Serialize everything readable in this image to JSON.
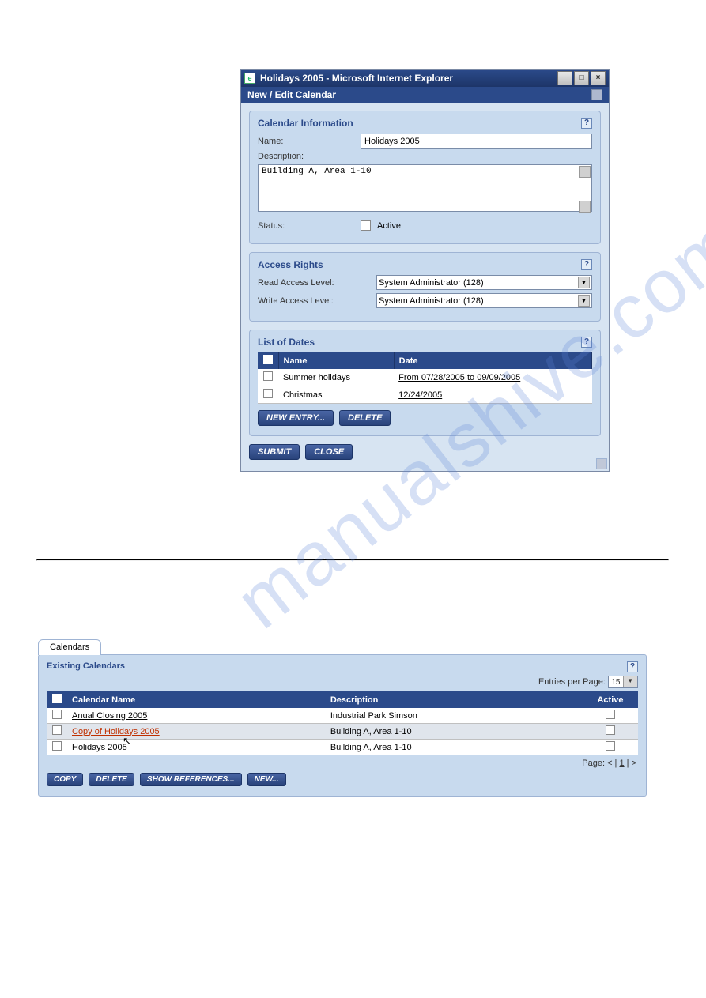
{
  "dialog": {
    "window_title": "Holidays 2005 - Microsoft Internet Explorer",
    "subheader": "New / Edit Calendar",
    "win_btns": {
      "min": "_",
      "max": "□",
      "close": "×"
    },
    "calendar_info": {
      "title": "Calendar Information",
      "name_label": "Name:",
      "name_value": "Holidays 2005",
      "description_label": "Description:",
      "description_value": "Building A, Area 1-10",
      "status_label": "Status:",
      "active_label": "Active"
    },
    "access_rights": {
      "title": "Access Rights",
      "read_label": "Read Access Level:",
      "read_value": "System Administrator (128)",
      "write_label": "Write Access Level:",
      "write_value": "System Administrator (128)"
    },
    "list_of_dates": {
      "title": "List of Dates",
      "col_name": "Name",
      "col_date": "Date",
      "rows": [
        {
          "name": "Summer holidays",
          "date": "From 07/28/2005 to 09/09/2005"
        },
        {
          "name": "Christmas",
          "date": "12/24/2005"
        }
      ],
      "btn_new_entry": "NEW ENTRY...",
      "btn_delete": "DELETE"
    },
    "btn_submit": "SUBMIT",
    "btn_close": "CLOSE"
  },
  "calendars": {
    "tab_label": "Calendars",
    "panel_title": "Existing Calendars",
    "entries_label": "Entries per Page:",
    "entries_value": "15",
    "col_name": "Calendar Name",
    "col_desc": "Description",
    "col_active": "Active",
    "rows": [
      {
        "name": "Anual Closing 2005",
        "desc": "Industrial Park Simson",
        "copy": false
      },
      {
        "name": "Copy of Holidays 2005",
        "desc": "Building A, Area 1-10",
        "copy": true
      },
      {
        "name": "Holidays 2005",
        "desc": "Building A, Area 1-10",
        "copy": false
      }
    ],
    "page_label_prefix": "Page: < |",
    "page_current": "1",
    "page_label_suffix": "| >",
    "btn_copy": "COPY",
    "btn_delete": "DELETE",
    "btn_showref": "SHOW REFERENCES...",
    "btn_new": "NEW..."
  },
  "watermark": "manualshive.com"
}
